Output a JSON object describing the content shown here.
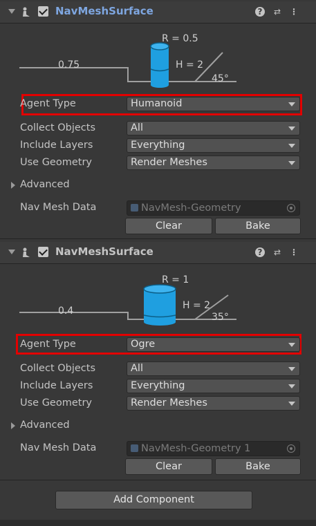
{
  "components": [
    {
      "title": "NavMeshSurface",
      "title_color": "#7ea6e0",
      "diagram": {
        "radius_label": "R = 0.5",
        "height_label": "H = 2",
        "step_label": "0.75",
        "slope_label": "45°"
      },
      "agent_type": {
        "label": "Agent Type",
        "value": "Humanoid"
      },
      "collect_objects": {
        "label": "Collect Objects",
        "value": "All"
      },
      "include_layers": {
        "label": "Include Layers",
        "value": "Everything"
      },
      "use_geometry": {
        "label": "Use Geometry",
        "value": "Render Meshes"
      },
      "advanced_label": "Advanced",
      "nav_mesh_data": {
        "label": "Nav Mesh Data",
        "value": "NavMesh-Geometry"
      },
      "clear_label": "Clear",
      "bake_label": "Bake"
    },
    {
      "title": "NavMeshSurface",
      "title_color": "#c4c4c4",
      "diagram": {
        "radius_label": "R = 1",
        "height_label": "H = 2",
        "step_label": "0.4",
        "slope_label": "35°"
      },
      "agent_type": {
        "label": "Agent Type",
        "value": "Ogre"
      },
      "collect_objects": {
        "label": "Collect Objects",
        "value": "All"
      },
      "include_layers": {
        "label": "Include Layers",
        "value": "Everything"
      },
      "use_geometry": {
        "label": "Use Geometry",
        "value": "Render Meshes"
      },
      "advanced_label": "Advanced",
      "nav_mesh_data": {
        "label": "Nav Mesh Data",
        "value": "NavMesh-Geometry 1"
      },
      "clear_label": "Clear",
      "bake_label": "Bake"
    }
  ],
  "add_component_label": "Add Component",
  "icons": {
    "help": "help-icon",
    "preset": "preset-icon",
    "menu": "kebab-menu-icon",
    "component": "navmesh-component-icon"
  },
  "colors": {
    "highlight_box": "#e30000",
    "cylinder": "#1f9fe0"
  }
}
